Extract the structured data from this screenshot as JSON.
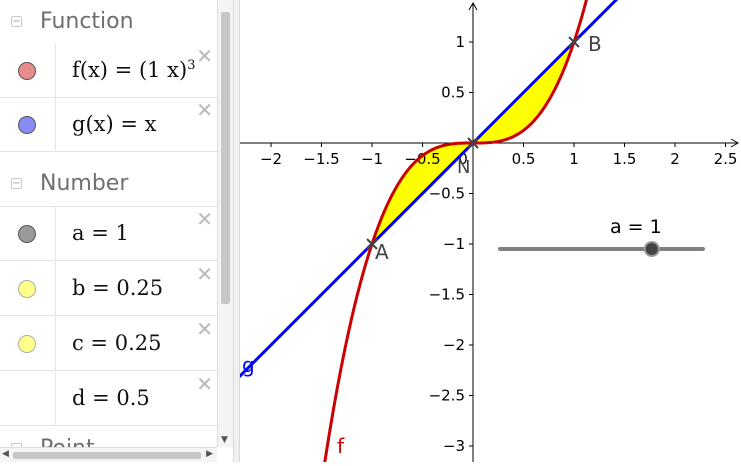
{
  "algebra": {
    "categories": {
      "function": "Function",
      "number": "Number",
      "point": "Point"
    },
    "toggle_glyph": "−",
    "delete_glyph": "✕",
    "functions": [
      {
        "definition": "f(x)  =  (1 x)",
        "exponent": "3",
        "color": "#e88b8b"
      },
      {
        "definition": "g(x)  =  x",
        "color": "#8a8af5"
      }
    ],
    "numbers": [
      {
        "definition": "a  =  1",
        "color": "#9a9a9a"
      },
      {
        "definition": "b  =  0.25",
        "color": "#ffff8c"
      },
      {
        "definition": "c  =  0.25",
        "color": "#ffff8c"
      },
      {
        "definition": "d  =  0.5",
        "color": ""
      }
    ]
  },
  "graphics": {
    "x_ticks": [
      "−2",
      "−1.5",
      "−1",
      "−0.5",
      "0",
      "0.5",
      "1",
      "1.5",
      "2",
      "2.5"
    ],
    "y_ticks": [
      "1",
      "0.5",
      "−0.5",
      "−1",
      "−1.5",
      "−2",
      "−2.5",
      "−3"
    ],
    "curve_f_label": "f",
    "line_g_label": "g",
    "point_A": "A",
    "point_B": "B",
    "origin_label": "N",
    "slider_label": "a = 1",
    "colors": {
      "f": "#cc0000",
      "g": "#0000ff",
      "fill": "#ffff00"
    }
  },
  "chart_data": {
    "type": "line",
    "xlim": [
      -2.3,
      2.5
    ],
    "ylim": [
      -3.1,
      1.4
    ],
    "grid": false,
    "series": [
      {
        "name": "f",
        "formula": "x^3",
        "color": "#cc0000"
      },
      {
        "name": "g",
        "formula": "x",
        "color": "#0000ff"
      }
    ],
    "points": [
      {
        "name": "A",
        "x": -1,
        "y": -1
      },
      {
        "name": "B",
        "x": 1,
        "y": 1
      },
      {
        "name": "N",
        "x": 0,
        "y": 0
      }
    ],
    "shaded_region": {
      "between": [
        "f",
        "g"
      ],
      "x_from": -1,
      "x_to": 1
    },
    "slider": {
      "name": "a",
      "value": 1,
      "min": -5,
      "max": 5
    }
  }
}
